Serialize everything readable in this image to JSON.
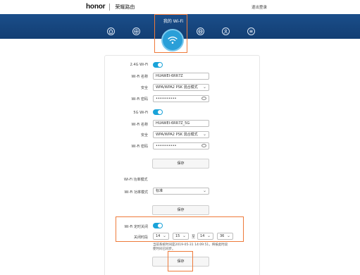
{
  "header": {
    "brand": "honor",
    "title": "荣耀路由",
    "logout": "退出登录"
  },
  "nav": {
    "current": "我的 Wi-Fi",
    "icons": [
      "home-icon",
      "globe-icon",
      "wifi-icon",
      "internet-icon",
      "user-icon",
      "menu-icon"
    ]
  },
  "wifi24": {
    "toggle_label": "2.4G Wi-Fi",
    "toggle_on": true,
    "name_label": "Wi-Fi 名称",
    "name_value": "HUAWEI-6RR7Z",
    "security_label": "安全",
    "security_value": "WPA/WPA2 PSK 混合模式",
    "password_label": "Wi-Fi 密码",
    "password_value": "••••••••••"
  },
  "wifi5": {
    "toggle_label": "5G Wi-Fi",
    "toggle_on": true,
    "name_label": "Wi-Fi 名称",
    "name_value": "HUAWEI-6RR7Z_5G",
    "security_label": "安全",
    "security_value": "WPA/WPA2 PSK 混合模式",
    "password_label": "Wi-Fi 密码",
    "password_value": "••••••••••"
  },
  "save1": "保存",
  "power": {
    "section_label": "Wi-Fi 功率模式",
    "mode_label": "Wi-Fi 功率模式",
    "mode_value": "标准"
  },
  "save2": "保存",
  "timer": {
    "toggle_label": "Wi-Fi 定时关闭",
    "toggle_on": true,
    "time_label": "关闭时段",
    "start_h": "14",
    "start_m": "15",
    "to": "至",
    "end_h": "14",
    "end_m": "36",
    "note_line1": "当前系统时间是2019-05-31 14:09:51，将按此时段",
    "note_line2": "使时间已同步。"
  },
  "save3": "保存",
  "colors": {
    "nav_bg": "#1b4e8a",
    "accent": "#1aa3d9",
    "highlight": "#ee7a3a"
  }
}
